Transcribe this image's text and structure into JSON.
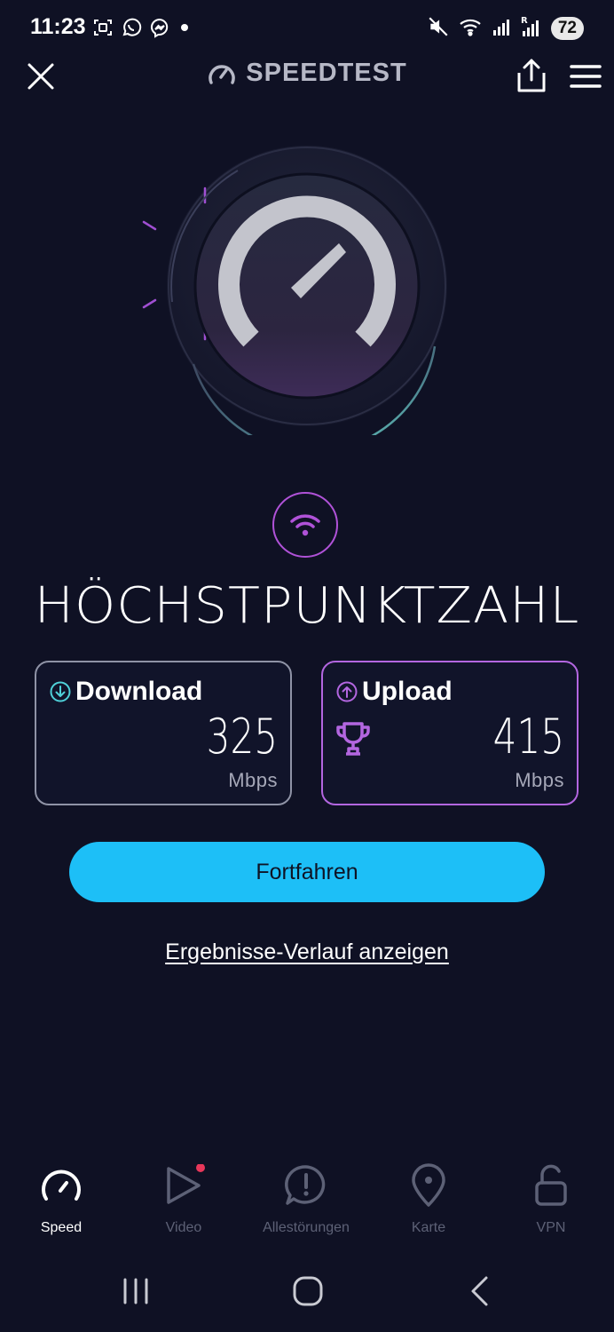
{
  "status_bar": {
    "time": "11:23",
    "battery": "72",
    "left_icons": [
      "screenshot-icon",
      "whatsapp-icon",
      "messenger-icon",
      "dot-icon"
    ],
    "right_icons": [
      "mute-icon",
      "wifi-icon",
      "signal-icon",
      "signal-roaming-icon"
    ]
  },
  "header": {
    "title": "SPEEDTEST",
    "icons": [
      "close-icon",
      "speedometer-icon",
      "share-icon",
      "menu-icon"
    ]
  },
  "result": {
    "connection_icon": "wifi-icon",
    "headline": "HÖCHSTPUNKTZAHL",
    "download": {
      "label": "Download",
      "value": "325",
      "unit": "Mbps",
      "icon": "arrow-down-circle-icon"
    },
    "upload": {
      "label": "Upload",
      "value": "415",
      "unit": "Mbps",
      "icon": "arrow-up-circle-icon",
      "badge_icon": "trophy-icon"
    }
  },
  "actions": {
    "continue_label": "Fortfahren",
    "history_link": "Ergebnisse-Verlauf anzeigen"
  },
  "bottom_nav": {
    "items": [
      {
        "label": "Speed",
        "icon": "speedometer-icon",
        "active": true
      },
      {
        "label": "Video",
        "icon": "play-icon",
        "active": false,
        "notification": true
      },
      {
        "label": "Allestörungen",
        "icon": "alert-icon",
        "active": false
      },
      {
        "label": "Karte",
        "icon": "map-pin-icon",
        "active": false
      },
      {
        "label": "VPN",
        "icon": "unlock-icon",
        "active": false
      }
    ]
  },
  "colors": {
    "background": "#0f1124",
    "accent_blue": "#1dbff7",
    "accent_purple": "#b366e0",
    "notification_red": "#e8375a"
  }
}
